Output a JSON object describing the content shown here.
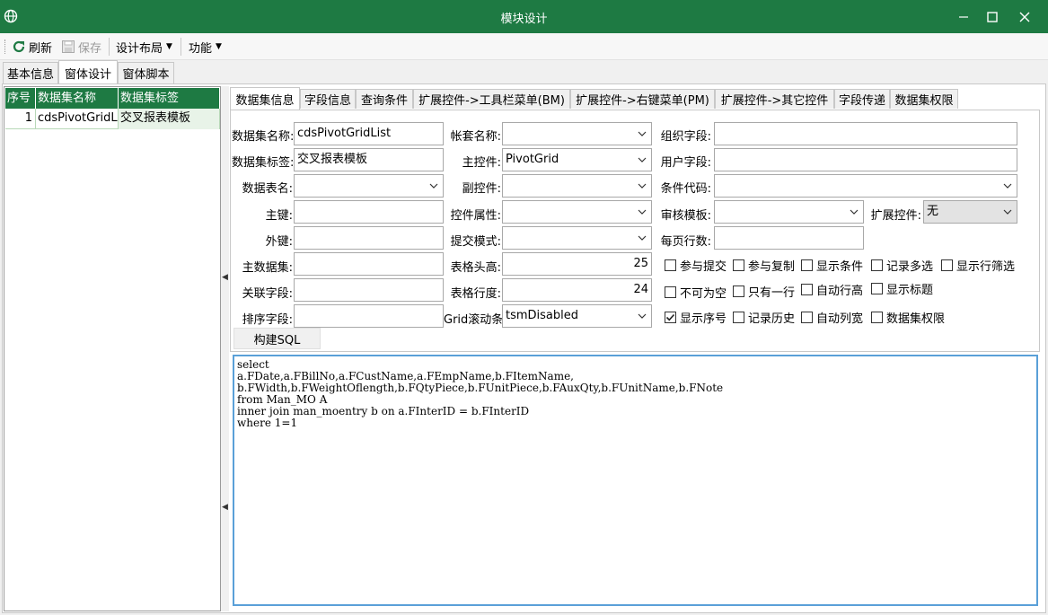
{
  "window": {
    "title": "模块设计",
    "icon": "globe-icon",
    "accent": "#1e7a43"
  },
  "toolbar": {
    "refresh_label": "刷新",
    "save_label": "保存",
    "layout_label": "设计布局",
    "function_label": "功能"
  },
  "main_tabs": [
    "基本信息",
    "窗体设计",
    "窗体脚本"
  ],
  "grid": {
    "headers": [
      "序号",
      "数据集名称",
      "数据集标签"
    ],
    "rows": [
      {
        "no": "1",
        "name": "cdsPivotGridLi",
        "label": "交叉报表模板"
      }
    ]
  },
  "sub_tabs": [
    "数据集信息",
    "字段信息",
    "查询条件",
    "扩展控件->工具栏菜单(BM)",
    "扩展控件->右键菜单(PM)",
    "扩展控件->其它控件",
    "字段传递",
    "数据集权限"
  ],
  "form": {
    "dataset_name": {
      "label": "数据集名称:",
      "value": "cdsPivotGridList"
    },
    "dataset_tag": {
      "label": "数据集标签:",
      "value": "交叉报表模板"
    },
    "table_name": {
      "label": "数据表名:",
      "value": ""
    },
    "primary_key": {
      "label": "主键:",
      "value": ""
    },
    "foreign_key": {
      "label": "外键:",
      "value": ""
    },
    "master_dataset": {
      "label": "主数据集:",
      "value": ""
    },
    "link_field": {
      "label": "关联字段:",
      "value": ""
    },
    "sort_field": {
      "label": "排序字段:",
      "value": ""
    },
    "account_name": {
      "label": "帐套名称:",
      "value": ""
    },
    "main_control": {
      "label": "主控件:",
      "value": "PivotGrid"
    },
    "sub_control": {
      "label": "副控件:",
      "value": ""
    },
    "control_props": {
      "label": "控件属性:",
      "value": ""
    },
    "submit_mode": {
      "label": "提交模式:",
      "value": ""
    },
    "header_height": {
      "label": "表格头高:",
      "value": "25"
    },
    "row_height": {
      "label": "表格行度:",
      "value": "24"
    },
    "grid_scroll": {
      "label": "Grid滚动条",
      "value": "tsmDisabled"
    },
    "org_field": {
      "label": "组织字段:",
      "value": ""
    },
    "user_field": {
      "label": "用户字段:",
      "value": ""
    },
    "condition_code": {
      "label": "条件代码:",
      "value": ""
    },
    "audit_template": {
      "label": "审核模板:",
      "value": ""
    },
    "ext_control": {
      "label": "扩展控件:",
      "value": "无"
    },
    "page_rows": {
      "label": "每页行数:",
      "value": ""
    }
  },
  "checkboxes": [
    {
      "label": "参与提交",
      "checked": false
    },
    {
      "label": "参与复制",
      "checked": false
    },
    {
      "label": "显示条件",
      "checked": false
    },
    {
      "label": "记录多选",
      "checked": false
    },
    {
      "label": "显示行筛选",
      "checked": false
    },
    {
      "label": "不可为空",
      "checked": false
    },
    {
      "label": "只有一行",
      "checked": false
    },
    {
      "label": "自动行高",
      "checked": false
    },
    {
      "label": "显示标题",
      "checked": false
    },
    {
      "label": "显示序号",
      "checked": true
    },
    {
      "label": "记录历史",
      "checked": false
    },
    {
      "label": "自动列宽",
      "checked": false
    },
    {
      "label": "数据集权限",
      "checked": false
    }
  ],
  "build_sql_label": "构建SQL",
  "sql_lines": [
    "select",
    "a.FDate,a.FBillNo,a.FCustName,a.FEmpName,b.FItemName,",
    "b.FWidth,b.FWeightOflength,b.FQtyPiece,b.FUnitPiece,b.FAuxQty,b.FUnitName,b.FNote",
    "from Man_MO A",
    "inner join man_moentry b on a.FInterID = b.FInterID",
    "where 1=1"
  ]
}
